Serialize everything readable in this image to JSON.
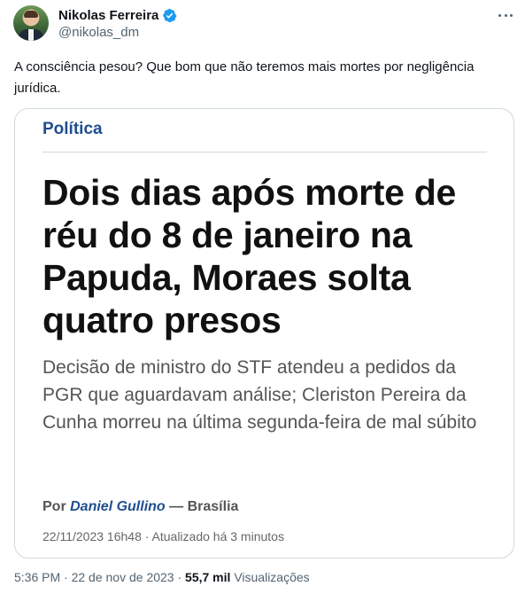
{
  "author": {
    "display_name": "Nikolas Ferreira",
    "handle": "@nikolas_dm"
  },
  "tweet": {
    "text": "A consciência pesou? Que bom que não teremos mais mortes por negligência jurídica."
  },
  "card": {
    "section": "Política",
    "headline": "Dois dias após morte de réu do 8 de janeiro na Papuda, Moraes solta quatro presos",
    "subhead": "Decisão de ministro do STF atendeu a pedidos da PGR que aguardavam análise; Cleriston Pereira da Cunha morreu na última segunda-feira de mal súbito",
    "byline_prefix": "Por",
    "byline_author": "Daniel Gullino",
    "byline_separator": "—",
    "byline_location": "Brasília",
    "dateline": "22/11/2023 16h48 · Atualizado há 3 minutos"
  },
  "meta": {
    "time": "5:36 PM",
    "date": "22 de nov de 2023",
    "separator": "·",
    "views_count": "55,7 mil",
    "views_label": "Visualizações"
  },
  "colors": {
    "verified": "#1d9bf0",
    "section": "#1f4e8f",
    "secondary_text": "#536471"
  },
  "icons": {
    "verified": "verified-badge-icon",
    "more": "more-options-icon"
  }
}
